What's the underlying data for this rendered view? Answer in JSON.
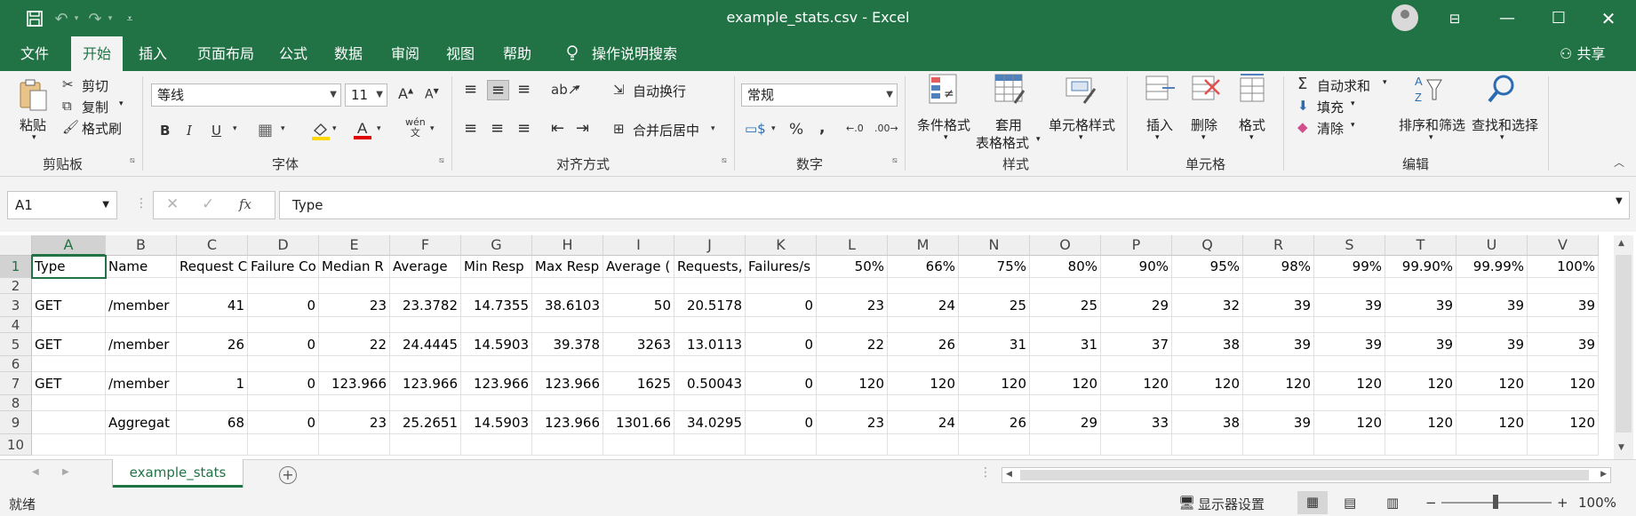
{
  "window": {
    "title": "example_stats.csv  -  Excel",
    "minimize_icon": "minimize-icon",
    "restore_icon": "maximize-icon",
    "close_icon": "close-icon"
  },
  "menu": {
    "tabs": [
      "文件",
      "开始",
      "插入",
      "页面布局",
      "公式",
      "数据",
      "审阅",
      "视图",
      "帮助"
    ],
    "active_tab": "开始",
    "tell_me": "操作说明搜索",
    "share": "共享"
  },
  "ribbon": {
    "clipboard": {
      "paste": "粘贴",
      "cut": "剪切",
      "copy": "复制",
      "format_painter": "格式刷",
      "label": "剪贴板"
    },
    "font": {
      "name": "等线",
      "size": "11",
      "label": "字体"
    },
    "alignment": {
      "wrap_text": "自动换行",
      "merge_center": "合并后居中",
      "label": "对齐方式"
    },
    "number": {
      "format": "常规",
      "label": "数字"
    },
    "styles": {
      "conditional": "条件格式",
      "table_line1": "套用",
      "table_line2": "表格格式",
      "cell_styles": "单元格样式",
      "label": "样式"
    },
    "cells": {
      "insert": "插入",
      "delete": "删除",
      "format": "格式",
      "label": "单元格"
    },
    "editing": {
      "autosum": "自动求和",
      "fill": "填充",
      "clear": "清除",
      "sort_filter": "排序和筛选",
      "find_select": "查找和选择",
      "label": "编辑"
    }
  },
  "formula_bar": {
    "name_box": "A1",
    "formula": "Type"
  },
  "grid": {
    "columns": [
      "A",
      "B",
      "C",
      "D",
      "E",
      "F",
      "G",
      "H",
      "I",
      "J",
      "K",
      "L",
      "M",
      "N",
      "O",
      "P",
      "Q",
      "R",
      "S",
      "T",
      "U",
      "V"
    ],
    "rows": [
      "1",
      "2",
      "3",
      "4",
      "5",
      "6",
      "7",
      "8",
      "9",
      "10"
    ],
    "cells": [
      [
        "Type",
        "Name",
        "Request C",
        "Failure Co",
        "Median R",
        "Average",
        "Min Resp",
        "Max Resp",
        "Average (",
        "Requests,",
        "Failures/s",
        "50%",
        "66%",
        "75%",
        "80%",
        "90%",
        "95%",
        "98%",
        "99%",
        "99.90%",
        "99.99%",
        "100%"
      ],
      [
        "",
        "",
        "",
        "",
        "",
        "",
        "",
        "",
        "",
        "",
        "",
        "",
        "",
        "",
        "",
        "",
        "",
        "",
        "",
        "",
        "",
        ""
      ],
      [
        "GET",
        "/member",
        "41",
        "0",
        "23",
        "23.3782",
        "14.7355",
        "38.6103",
        "50",
        "20.5178",
        "0",
        "23",
        "24",
        "25",
        "25",
        "29",
        "32",
        "39",
        "39",
        "39",
        "39",
        "39"
      ],
      [
        "",
        "",
        "",
        "",
        "",
        "",
        "",
        "",
        "",
        "",
        "",
        "",
        "",
        "",
        "",
        "",
        "",
        "",
        "",
        "",
        "",
        ""
      ],
      [
        "GET",
        "/member",
        "26",
        "0",
        "22",
        "24.4445",
        "14.5903",
        "39.378",
        "3263",
        "13.0113",
        "0",
        "22",
        "26",
        "31",
        "31",
        "37",
        "38",
        "39",
        "39",
        "39",
        "39",
        "39"
      ],
      [
        "",
        "",
        "",
        "",
        "",
        "",
        "",
        "",
        "",
        "",
        "",
        "",
        "",
        "",
        "",
        "",
        "",
        "",
        "",
        "",
        "",
        ""
      ],
      [
        "GET",
        "/member",
        "1",
        "0",
        "123.966",
        "123.966",
        "123.966",
        "123.966",
        "1625",
        "0.50043",
        "0",
        "120",
        "120",
        "120",
        "120",
        "120",
        "120",
        "120",
        "120",
        "120",
        "120",
        "120"
      ],
      [
        "",
        "",
        "",
        "",
        "",
        "",
        "",
        "",
        "",
        "",
        "",
        "",
        "",
        "",
        "",
        "",
        "",
        "",
        "",
        "",
        "",
        ""
      ],
      [
        "",
        "Aggregat",
        "68",
        "0",
        "23",
        "25.2651",
        "14.5903",
        "123.966",
        "1301.66",
        "34.0295",
        "0",
        "23",
        "24",
        "26",
        "29",
        "33",
        "38",
        "39",
        "120",
        "120",
        "120",
        "120"
      ],
      [
        "",
        "",
        "",
        "",
        "",
        "",
        "",
        "",
        "",
        "",
        "",
        "",
        "",
        "",
        "",
        "",
        "",
        "",
        "",
        "",
        "",
        ""
      ]
    ]
  },
  "sheet_tabs": {
    "active": "example_stats"
  },
  "status": {
    "ready": "就绪",
    "display_settings": "显示器设置",
    "zoom": "100%"
  }
}
